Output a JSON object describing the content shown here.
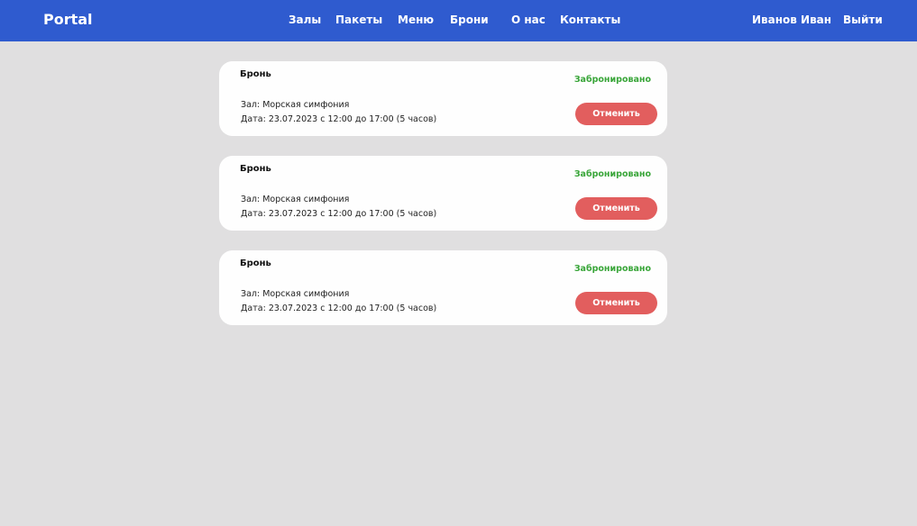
{
  "header": {
    "brand": "Portal",
    "nav": [
      "Залы",
      "Пакеты",
      "Меню",
      "Брони",
      "О нас",
      "Контакты"
    ],
    "user_name": "Иванов Иван",
    "logout": "Выйти"
  },
  "bookings": [
    {
      "title": "Бронь",
      "hall": "Зал: Морская симфония",
      "date": "Дата: 23.07.2023 с 12:00 до 17:00 (5 часов)",
      "status": "Забронировано",
      "cancel_label": "Отменить"
    },
    {
      "title": "Бронь",
      "hall": "Зал: Морская симфония",
      "date": "Дата: 23.07.2023 с 12:00 до 17:00 (5 часов)",
      "status": "Забронировано",
      "cancel_label": "Отменить"
    },
    {
      "title": "Бронь",
      "hall": "Зал: Морская симфония",
      "date": "Дата: 23.07.2023 с 12:00 до 17:00 (5 часов)",
      "status": "Забронировано",
      "cancel_label": "Отменить"
    }
  ],
  "colors": {
    "header_bg": "#2f5bcf",
    "page_bg": "#e0dfe0",
    "status": "#3aa63a",
    "cancel_button": "#e25e5e"
  }
}
